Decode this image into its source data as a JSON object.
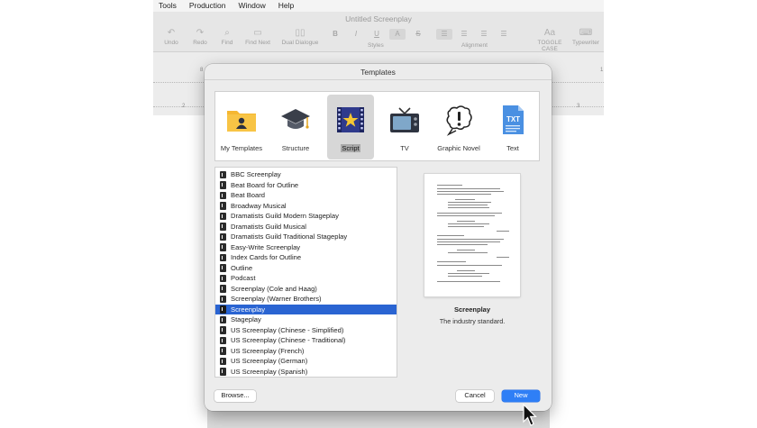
{
  "menubar": [
    "Tools",
    "Production",
    "Window",
    "Help"
  ],
  "window": {
    "title": "Untitled Screenplay",
    "toolbar": {
      "undo": "Undo",
      "redo": "Redo",
      "find": "Find",
      "find_next": "Find Next",
      "dual_dialogue": "Dual Dialogue",
      "styles_label": "Styles",
      "alignment_label": "Alignment",
      "toggle_case": "TOGGLE CASE",
      "typewriter": "Typewriter",
      "format_buttons": [
        "B",
        "I",
        "U",
        "A",
        "S"
      ],
      "case_glyph": "Aa"
    },
    "ruler": {
      "marks_top": [
        "8",
        "1"
      ],
      "marks_bottom": [
        "2",
        "3"
      ]
    }
  },
  "dialog": {
    "title": "Templates",
    "categories": [
      {
        "label": "My Templates",
        "icon": "folder-person-icon"
      },
      {
        "label": "Structure",
        "icon": "graduation-cap-icon"
      },
      {
        "label": "Script",
        "icon": "film-star-icon",
        "selected": true
      },
      {
        "label": "TV",
        "icon": "television-icon"
      },
      {
        "label": "Graphic Novel",
        "icon": "speech-bubble-exclamation-icon"
      },
      {
        "label": "Text",
        "icon": "txt-document-icon"
      }
    ],
    "templates": [
      "BBC Screenplay",
      "Beat Board for Outline",
      "Beat Board",
      "Broadway Musical",
      "Dramatists Guild Modern Stageplay",
      "Dramatists Guild Musical",
      "Dramatists Guild Traditional Stageplay",
      "Easy-Write Screenplay",
      "Index Cards for Outline",
      "Outline",
      "Podcast",
      "Screenplay (Cole and Haag)",
      "Screenplay (Warner Brothers)",
      "Screenplay",
      "Stageplay",
      "US Screenplay (Chinese - Simplified)",
      "US Screenplay (Chinese - Traditional)",
      "US Screenplay (French)",
      "US Screenplay (German)",
      "US Screenplay (Spanish)"
    ],
    "selected_template": "Screenplay",
    "preview": {
      "title": "Screenplay",
      "description": "The industry standard."
    },
    "buttons": {
      "browse": "Browse...",
      "cancel": "Cancel",
      "new": "New"
    }
  },
  "colors": {
    "accent": "#2f7ff6",
    "selection": "#2a64d2"
  }
}
